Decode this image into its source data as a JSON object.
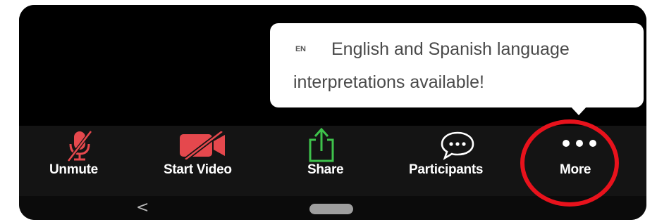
{
  "tooltip": {
    "lang_badge": "EN",
    "line1": "English and Spanish language",
    "line2": "interpretations available!"
  },
  "toolbar": {
    "items": [
      {
        "label": "Unmute",
        "icon": "muted-microphone-icon",
        "color": "#e5484d"
      },
      {
        "label": "Start Video",
        "icon": "video-off-icon",
        "color": "#e5484d"
      },
      {
        "label": "Share",
        "icon": "share-upload-icon",
        "color": "#3ec24b"
      },
      {
        "label": "Participants",
        "icon": "chat-bubble-icon",
        "color": "#ffffff"
      },
      {
        "label": "More",
        "icon": "more-dots-icon",
        "color": "#ffffff"
      }
    ]
  },
  "navbar": {
    "back_glyph": "<"
  },
  "colors": {
    "annotation": "#e8121c",
    "background": "#000000"
  }
}
